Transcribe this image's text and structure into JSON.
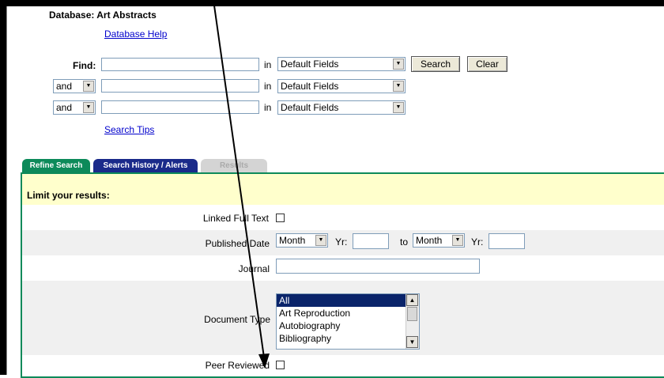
{
  "database": {
    "title": "Database: Art Abstracts",
    "help_link": "Database Help"
  },
  "search": {
    "find_label": "Find:",
    "in_label": "in",
    "rows": [
      {
        "operator": "",
        "field": "Default Fields",
        "value": ""
      },
      {
        "operator": "and",
        "field": "Default Fields",
        "value": ""
      },
      {
        "operator": "and",
        "field": "Default Fields",
        "value": ""
      }
    ],
    "search_button": "Search",
    "clear_button": "Clear",
    "tips_link": "Search Tips"
  },
  "tabs": [
    {
      "label": "Refine Search"
    },
    {
      "label": "Search History / Alerts"
    },
    {
      "label": "Results"
    }
  ],
  "limits": {
    "title": "Limit your results:",
    "linked_full_text": "Linked Full Text",
    "published_date": {
      "label": "Published Date",
      "from_month": "Month",
      "yr_label": "Yr:",
      "to_label": "to",
      "to_month": "Month",
      "yr2_label": "Yr:"
    },
    "journal": "Journal",
    "document_type": {
      "label": "Document Type",
      "options": [
        "All",
        "Art Reproduction",
        "Autobiography",
        "Bibliography"
      ],
      "selected": "All"
    },
    "peer_reviewed": "Peer Reviewed"
  },
  "colors": {
    "tab_refine": "#0d8a5a",
    "tab_history": "#1a2a8a",
    "limit_bar": "#ffffcc"
  }
}
